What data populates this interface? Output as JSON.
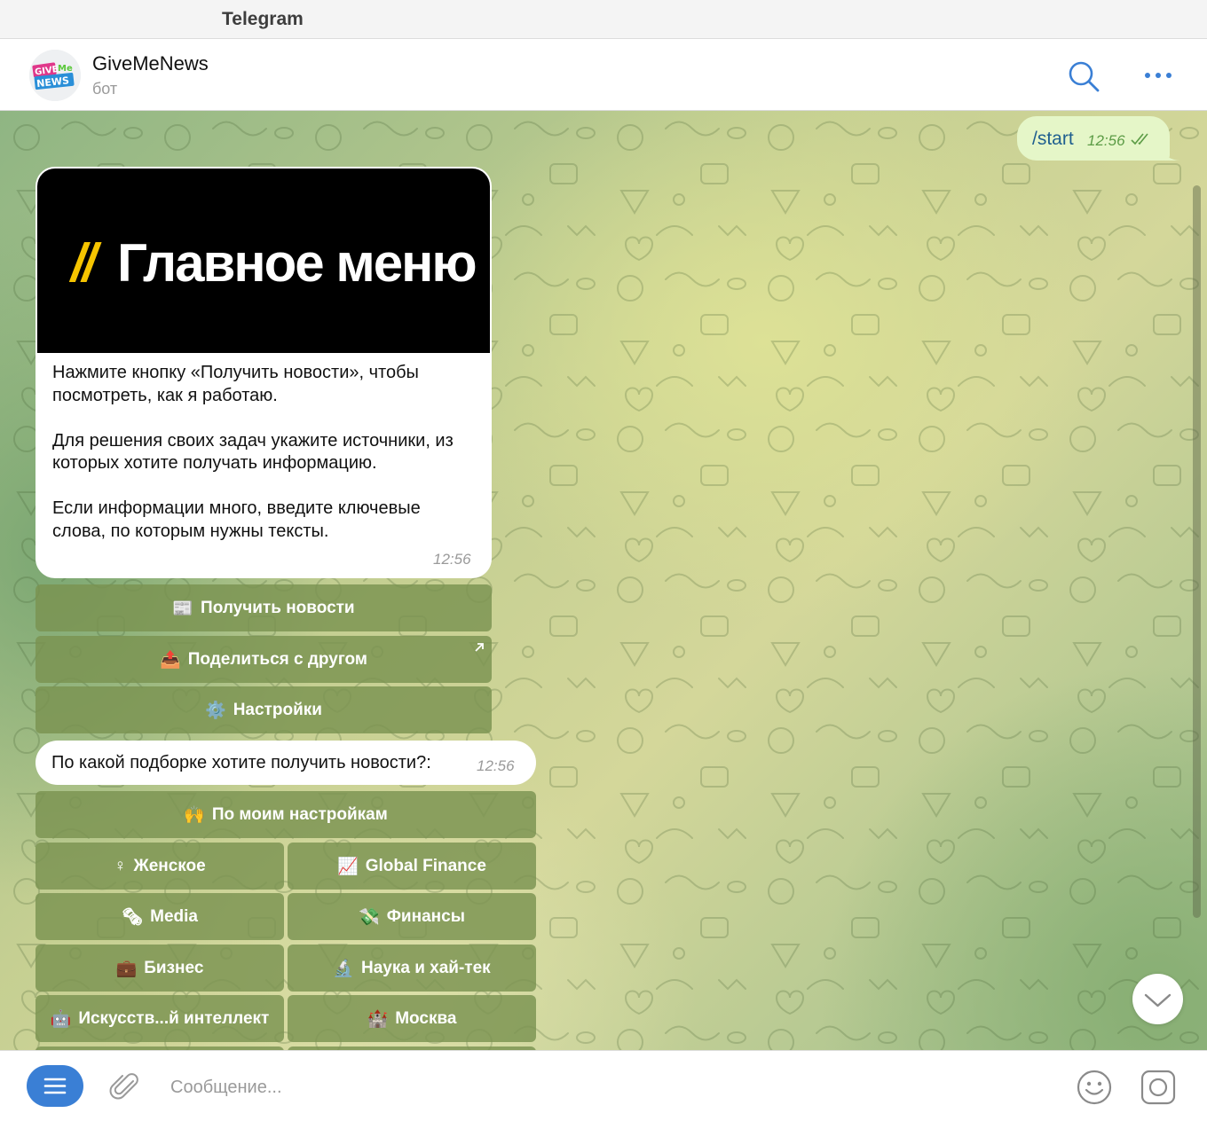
{
  "window": {
    "title": "Telegram"
  },
  "chat": {
    "name": "GiveMeNews",
    "status": "бот",
    "avatar_line1": "GIVE",
    "avatar_line1b": "Me",
    "avatar_line2": "NEWS"
  },
  "messages": {
    "outgoing": {
      "text": "/start",
      "time": "12:56"
    },
    "card": {
      "banner_slashes": "//",
      "banner_title": "Главное меню",
      "paragraphs": [
        "Нажмите кнопку «Получить новости», чтобы посмотреть, как я работаю.",
        "Для решения своих задач укажите источники, из которых хотите получать информацию.",
        "Если информации много, введите ключевые слова, по которым нужны тексты."
      ],
      "time": "12:56"
    },
    "question": {
      "text": "По какой подборке хотите получить новости?:",
      "time": "12:56"
    }
  },
  "keyboard1": [
    {
      "emoji": "📰",
      "label": "Получить новости"
    },
    {
      "emoji": "📤",
      "label": "Поделиться с другом"
    },
    {
      "emoji": "⚙️",
      "label": "Настройки"
    }
  ],
  "keyboard2": {
    "full": {
      "emoji": "🙌",
      "label": "По моим настройкам"
    },
    "grid": [
      {
        "emoji": "♀",
        "label": "Женское"
      },
      {
        "emoji": "📈",
        "label": "Global Finance"
      },
      {
        "emoji": "🗞",
        "label": "Media"
      },
      {
        "emoji": "💸",
        "label": "Финансы"
      },
      {
        "emoji": "💼",
        "label": "Бизнес"
      },
      {
        "emoji": "🔬",
        "label": "Наука и хай-тек"
      },
      {
        "emoji": "🤖",
        "label": "Искусств...й интеллект"
      },
      {
        "emoji": "🏰",
        "label": "Москва"
      }
    ]
  },
  "input": {
    "placeholder": "Сообщение..."
  },
  "colors": {
    "accent": "#3a7fd5",
    "outgoing_bubble": "#e5f6c8",
    "keyboard_button": "#7a9250"
  }
}
